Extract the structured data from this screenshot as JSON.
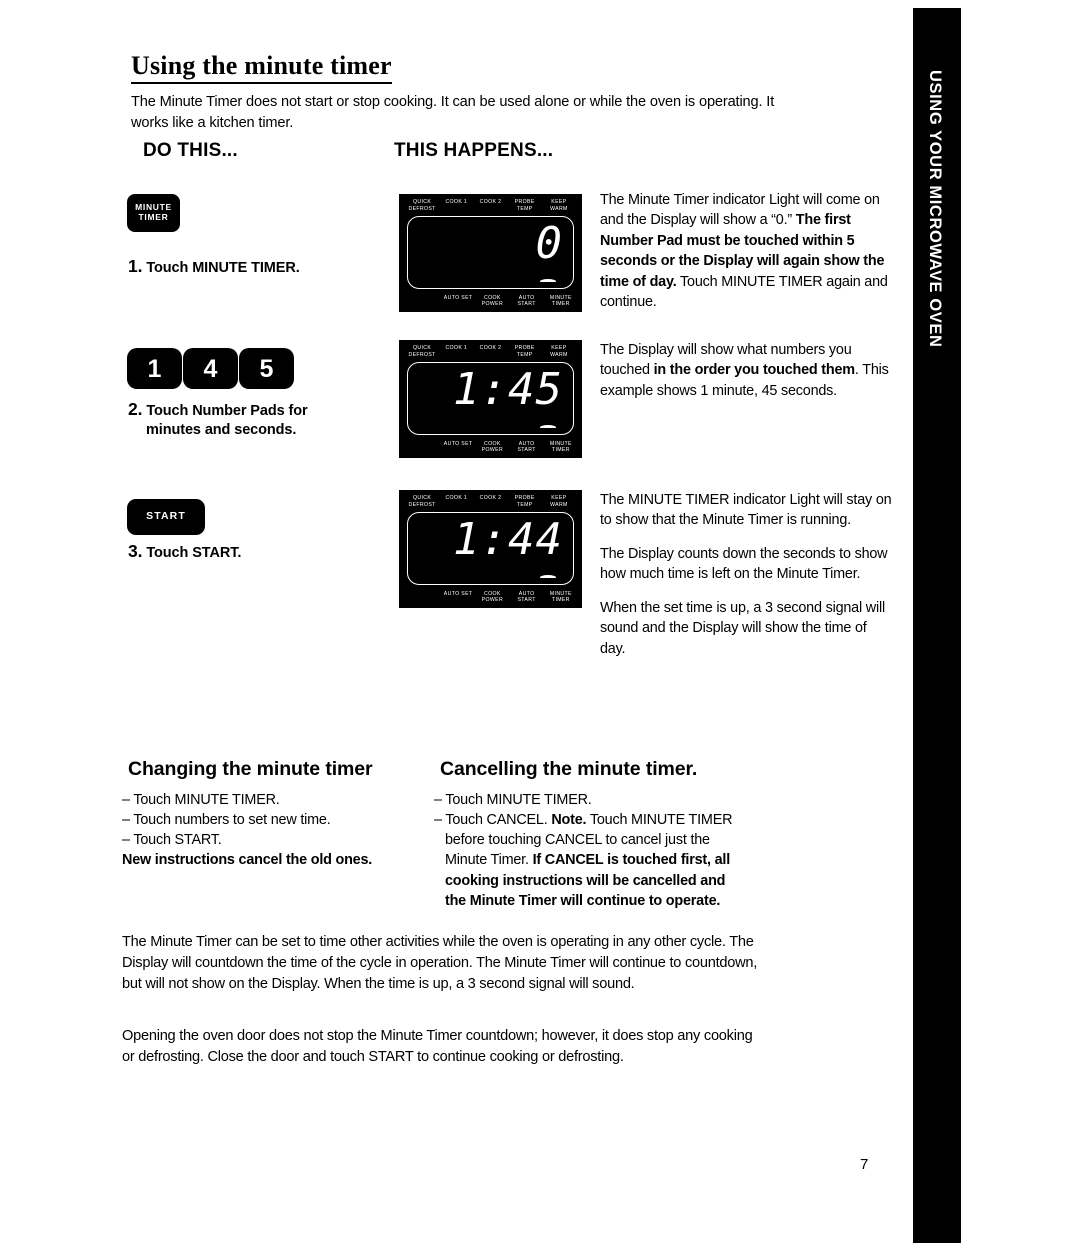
{
  "page": {
    "title": "Using the minute timer",
    "intro": "The Minute Timer does not start or stop cooking. It can be used alone or while the oven is operating. It works like a kitchen timer.",
    "page_number": "7",
    "side_tab_label": "USING YOUR MICROWAVE OVEN"
  },
  "columns": {
    "do_this": "DO THIS...",
    "this_happens": "THIS HAPPENS..."
  },
  "steps": [
    {
      "number": "1.",
      "caption": "Touch MINUTE TIMER.",
      "key": {
        "type": "minute-timer-pad",
        "line1": "MINUTE",
        "line2": "TIMER"
      }
    },
    {
      "number": "2.",
      "caption_line1": "Touch Number Pads for",
      "caption_line2": "minutes and seconds.",
      "keys": [
        "1",
        "4",
        "5"
      ]
    },
    {
      "number": "3.",
      "caption": "Touch START.",
      "key": {
        "type": "start-pad",
        "label": "START"
      }
    }
  ],
  "displays": [
    {
      "top_labels": [
        "QUICK DEFROST",
        "COOK 1",
        "COOK 2",
        "PROBE TEMP",
        "KEEP WARM"
      ],
      "bottom_labels": [
        "AUTO SET",
        "COOK POWER",
        "AUTO START",
        "MINUTE TIMER"
      ],
      "reading": "0"
    },
    {
      "top_labels": [
        "QUICK DEFROST",
        "COOK 1",
        "COOK 2",
        "PROBE TEMP",
        "KEEP WARM"
      ],
      "bottom_labels": [
        "AUTO SET",
        "COOK POWER",
        "AUTO START",
        "MINUTE TIMER"
      ],
      "reading": "1:45"
    },
    {
      "top_labels": [
        "QUICK DEFROST",
        "COOK 1",
        "COOK 2",
        "PROBE TEMP",
        "KEEP WARM"
      ],
      "bottom_labels": [
        "AUTO SET",
        "COOK POWER",
        "AUTO START",
        "MINUTE TIMER"
      ],
      "reading": "1:44"
    }
  ],
  "explanations": {
    "step1": {
      "lead": "The Minute Timer indicator Light will come on and the Display will show a “0.” ",
      "bold": "The first Number Pad must be touched within 5 seconds or the Display will again show the time of day.",
      "tail": " Touch MINUTE TIMER again and continue."
    },
    "step2": {
      "lead": "The Display will show what numbers you touched ",
      "bold": "in the order you touched them",
      "tail": ". This example shows 1 minute, 45 seconds."
    },
    "step3": {
      "para1": "The MINUTE TIMER indicator Light will stay on to show that the Minute Timer is running.",
      "para2": "The Display counts down the seconds to show how much time is left on the Minute Timer.",
      "para3": "When the set time is up, a 3 second signal will sound and the Display will show the time of day."
    }
  },
  "changing_section": {
    "heading": "Changing the minute timer",
    "bullets": [
      "– Touch MINUTE TIMER.",
      "– Touch numbers to set new time.",
      "– Touch START."
    ],
    "bold_note": "New instructions cancel the old ones."
  },
  "cancelling_section": {
    "heading": "Cancelling the minute timer.",
    "bullet1": "– Touch MINUTE TIMER.",
    "bullet2_lead": "– Touch CANCEL. ",
    "bullet2_bold_note": "Note.",
    "bullet2_mid": " Touch MINUTE TIMER before touching CANCEL to cancel just the Minute Timer. ",
    "bullet2_bold_tail": "If CANCEL is touched first, all cooking instructions will be cancelled and the Minute Timer will continue to operate."
  },
  "footer_paragraphs": {
    "p1": "The Minute Timer can be set to time other activities while the oven is operating in any other cycle. The Display will countdown the time of the cycle in operation. The Minute Timer will continue to countdown, but will not show on the Display. When the time is up, a 3 second signal will sound.",
    "p2": "Opening the oven door does not stop the Minute Timer countdown; however, it does stop any cooking or defrosting. Close the door and touch START to continue cooking or defrosting."
  }
}
